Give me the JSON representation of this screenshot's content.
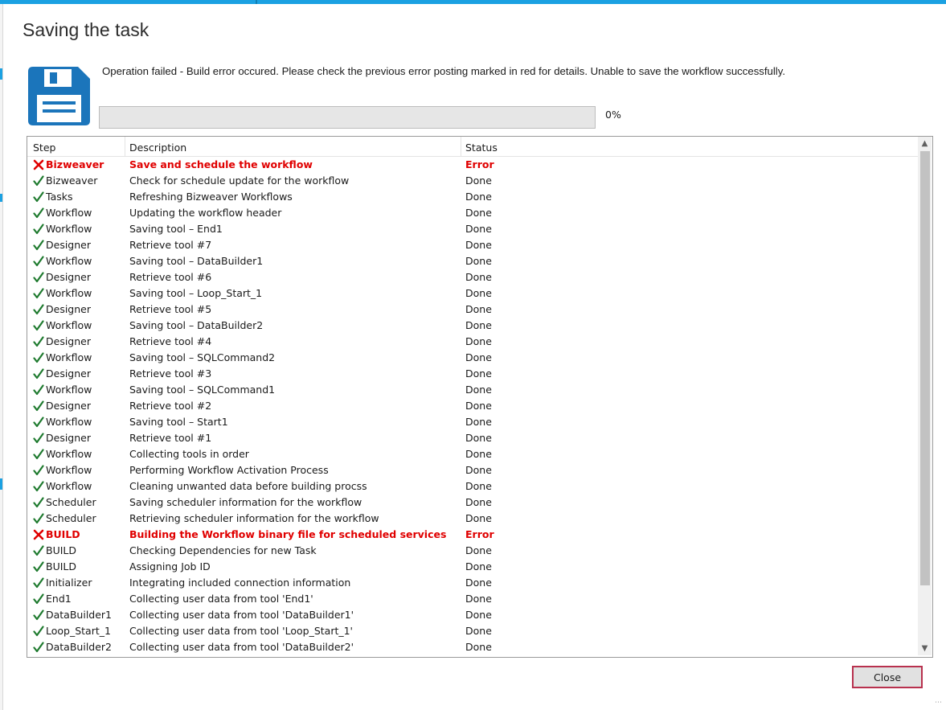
{
  "dialog": {
    "title": "Saving the task",
    "icon": "save-disk-icon",
    "message": "Operation failed - Build error occured. Please check the previous error posting marked in red for details. Unable to save the workflow successfully.",
    "progress": {
      "value": 0,
      "label": "0%"
    },
    "close_label": "Close"
  },
  "colors": {
    "accent": "#1ba1e2",
    "error": "#e00000",
    "done_check": "#1e7a2e",
    "icon_blue": "#1b75bb"
  },
  "grid": {
    "columns": [
      "Step",
      "Description",
      "Status"
    ],
    "rows": [
      {
        "step": "Bizweaver",
        "description": "Save and schedule the workflow",
        "status": "Error",
        "state": "error"
      },
      {
        "step": "Bizweaver",
        "description": "Check for schedule update for the workflow",
        "status": "Done",
        "state": "done"
      },
      {
        "step": "Tasks",
        "description": "Refreshing Bizweaver Workflows",
        "status": "Done",
        "state": "done"
      },
      {
        "step": "Workflow",
        "description": "Updating the workflow header",
        "status": "Done",
        "state": "done"
      },
      {
        "step": "Workflow",
        "description": "Saving tool – End1",
        "status": "Done",
        "state": "done"
      },
      {
        "step": "Designer",
        "description": "Retrieve tool #7",
        "status": "Done",
        "state": "done"
      },
      {
        "step": "Workflow",
        "description": "Saving tool – DataBuilder1",
        "status": "Done",
        "state": "done"
      },
      {
        "step": "Designer",
        "description": "Retrieve tool #6",
        "status": "Done",
        "state": "done"
      },
      {
        "step": "Workflow",
        "description": "Saving tool – Loop_Start_1",
        "status": "Done",
        "state": "done"
      },
      {
        "step": "Designer",
        "description": "Retrieve tool #5",
        "status": "Done",
        "state": "done"
      },
      {
        "step": "Workflow",
        "description": "Saving tool – DataBuilder2",
        "status": "Done",
        "state": "done"
      },
      {
        "step": "Designer",
        "description": "Retrieve tool #4",
        "status": "Done",
        "state": "done"
      },
      {
        "step": "Workflow",
        "description": "Saving tool – SQLCommand2",
        "status": "Done",
        "state": "done"
      },
      {
        "step": "Designer",
        "description": "Retrieve tool #3",
        "status": "Done",
        "state": "done"
      },
      {
        "step": "Workflow",
        "description": "Saving tool – SQLCommand1",
        "status": "Done",
        "state": "done"
      },
      {
        "step": "Designer",
        "description": "Retrieve tool #2",
        "status": "Done",
        "state": "done"
      },
      {
        "step": "Workflow",
        "description": "Saving tool – Start1",
        "status": "Done",
        "state": "done"
      },
      {
        "step": "Designer",
        "description": "Retrieve tool #1",
        "status": "Done",
        "state": "done"
      },
      {
        "step": "Workflow",
        "description": "Collecting tools in order",
        "status": "Done",
        "state": "done"
      },
      {
        "step": "Workflow",
        "description": "Performing Workflow Activation Process",
        "status": "Done",
        "state": "done"
      },
      {
        "step": "Workflow",
        "description": "Cleaning unwanted data before building procss",
        "status": "Done",
        "state": "done"
      },
      {
        "step": "Scheduler",
        "description": "Saving scheduler information for the workflow",
        "status": "Done",
        "state": "done"
      },
      {
        "step": "Scheduler",
        "description": "Retrieving scheduler information for the workflow",
        "status": "Done",
        "state": "done"
      },
      {
        "step": "BUILD",
        "description": "Building the Workflow binary file for scheduled services",
        "status": "Error",
        "state": "error"
      },
      {
        "step": "BUILD",
        "description": "Checking Dependencies for new Task",
        "status": "Done",
        "state": "done"
      },
      {
        "step": "BUILD",
        "description": "Assigning Job ID",
        "status": "Done",
        "state": "done"
      },
      {
        "step": "Initializer",
        "description": "Integrating included connection information",
        "status": "Done",
        "state": "done"
      },
      {
        "step": "End1",
        "description": "Collecting user data from tool 'End1'",
        "status": "Done",
        "state": "done"
      },
      {
        "step": "DataBuilder1",
        "description": "Collecting user data from tool 'DataBuilder1'",
        "status": "Done",
        "state": "done"
      },
      {
        "step": "Loop_Start_1",
        "description": "Collecting user data from tool 'Loop_Start_1'",
        "status": "Done",
        "state": "done"
      },
      {
        "step": "DataBuilder2",
        "description": "Collecting user data from tool 'DataBuilder2'",
        "status": "Done",
        "state": "done"
      }
    ]
  }
}
